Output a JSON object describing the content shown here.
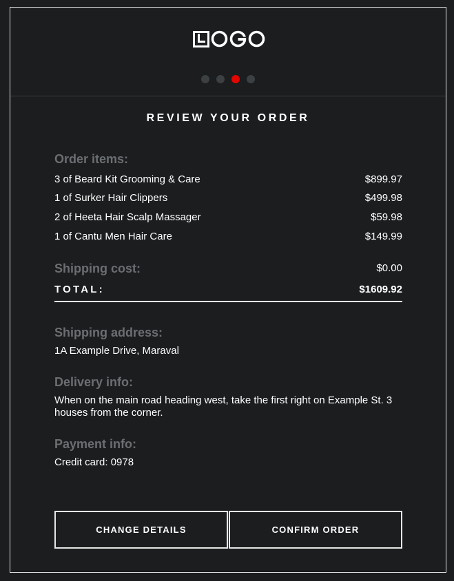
{
  "header": {
    "logo_text": "LOGO",
    "steps": [
      {
        "state": "inactive"
      },
      {
        "state": "inactive"
      },
      {
        "state": "active"
      },
      {
        "state": "inactive"
      }
    ],
    "active_step_color": "#e10600"
  },
  "title": "REVIEW YOUR ORDER",
  "order": {
    "items_label": "Order items:",
    "items": [
      {
        "description": "3 of Beard Kit Grooming & Care",
        "price": "$899.97"
      },
      {
        "description": "1 of Surker Hair Clippers",
        "price": "$499.98"
      },
      {
        "description": "2 of Heeta Hair Scalp Massager",
        "price": "$59.98"
      },
      {
        "description": "1 of Cantu Men Hair Care",
        "price": "$149.99"
      }
    ],
    "shipping_label": "Shipping cost:",
    "shipping_value": "$0.00",
    "total_label": "TOTAL:",
    "total_value": "$1609.92"
  },
  "shipping_address": {
    "label": "Shipping address:",
    "value": "1A Example Drive, Maraval"
  },
  "delivery_info": {
    "label": "Delivery info:",
    "value": "When on the main road heading west, take the first right on Example St. 3 houses from the corner."
  },
  "payment_info": {
    "label": "Payment info:",
    "value": "Credit card: 0978"
  },
  "actions": {
    "change_label": "CHANGE DETAILS",
    "confirm_label": "CONFIRM ORDER"
  }
}
